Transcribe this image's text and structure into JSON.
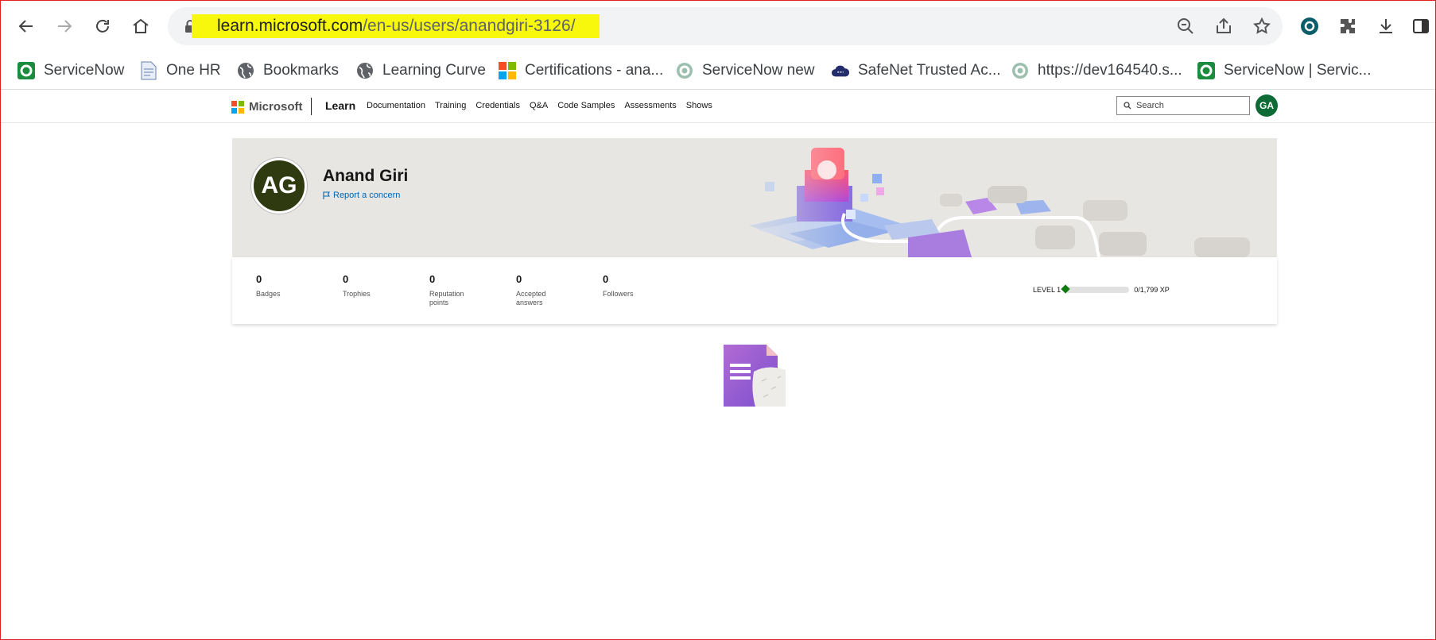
{
  "browser": {
    "url_host": "learn.microsoft.com",
    "url_path": "/en-us/users/anandgiri-3126/"
  },
  "bookmarks": [
    {
      "label": "ServiceNow",
      "icon": "servicenow-icon"
    },
    {
      "label": "One HR",
      "icon": "document-icon"
    },
    {
      "label": "Bookmarks",
      "icon": "globe-icon"
    },
    {
      "label": "Learning Curve",
      "icon": "globe-icon"
    },
    {
      "label": "Certifications - ana...",
      "icon": "microsoft-icon"
    },
    {
      "label": "ServiceNow new",
      "icon": "servicenow-icon"
    },
    {
      "label": "SafeNet Trusted Ac...",
      "icon": "cloud-icon"
    },
    {
      "label": "https://dev164540.s...",
      "icon": "servicenow-icon"
    },
    {
      "label": "ServiceNow | Servic...",
      "icon": "servicenow-icon"
    }
  ],
  "learn_header": {
    "brand": "Microsoft",
    "product": "Learn",
    "nav": [
      "Documentation",
      "Training",
      "Credentials",
      "Q&A",
      "Code Samples",
      "Assessments",
      "Shows"
    ],
    "search_placeholder": "Search",
    "user_initials": "GA"
  },
  "profile": {
    "initials": "AG",
    "name": "Anand Giri",
    "report_link": "Report a concern"
  },
  "stats": [
    {
      "value": "0",
      "label": "Badges"
    },
    {
      "value": "0",
      "label": "Trophies"
    },
    {
      "value": "0",
      "label": "Reputation points"
    },
    {
      "value": "0",
      "label": "Accepted answers"
    },
    {
      "value": "0",
      "label": "Followers"
    }
  ],
  "level": {
    "label": "LEVEL 1",
    "xp": "0/1,799 XP",
    "progress": 0
  },
  "colors": {
    "url_highlight": "#f7f80c",
    "avatar_user": "#0e6b35",
    "avatar_profile": "#2f3a10",
    "link": "#0065b3",
    "level_green": "#107c10"
  }
}
